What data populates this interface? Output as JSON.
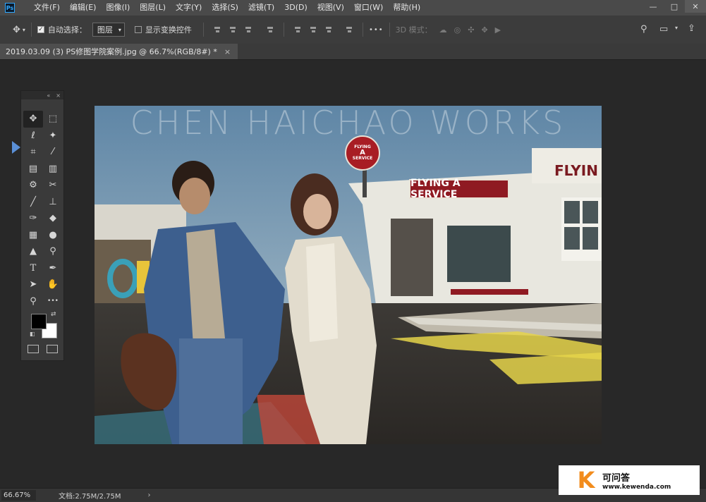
{
  "menubar": {
    "logo": "Ps",
    "items": [
      "文件(F)",
      "编辑(E)",
      "图像(I)",
      "图层(L)",
      "文字(Y)",
      "选择(S)",
      "滤镜(T)",
      "3D(D)",
      "视图(V)",
      "窗口(W)",
      "帮助(H)"
    ],
    "window_buttons": [
      "—",
      "□",
      "✕"
    ]
  },
  "optionsbar": {
    "auto_select_label": "自动选择：",
    "auto_select_checked": true,
    "layer_dropdown": "图层",
    "show_transform_label": "显示变换控件",
    "show_transform_checked": false,
    "more": "•••",
    "mode_3d_label": "3D 模式："
  },
  "document_tab": {
    "title": "2019.03.09  (3)  PS修图学院案例.jpg @ 66.7%(RGB/8#) *",
    "close": "×"
  },
  "toolbar": {
    "header_icons": [
      "«",
      "×"
    ],
    "tools": [
      {
        "name": "move-tool",
        "glyph": "✥"
      },
      {
        "name": "marquee-tool",
        "glyph": "⬚"
      },
      {
        "name": "lasso-tool",
        "glyph": "ℓ"
      },
      {
        "name": "magic-wand-tool",
        "glyph": "✦"
      },
      {
        "name": "crop-tool",
        "glyph": "⌗"
      },
      {
        "name": "eyedropper-tool",
        "glyph": "⁄"
      },
      {
        "name": "spot-healing-tool",
        "glyph": "▤"
      },
      {
        "name": "patch-tool",
        "glyph": "▥"
      },
      {
        "name": "content-aware-tool",
        "glyph": "⚙"
      },
      {
        "name": "red-eye-tool",
        "glyph": "✂"
      },
      {
        "name": "brush-tool",
        "glyph": "╱"
      },
      {
        "name": "stamp-tool",
        "glyph": "⊥"
      },
      {
        "name": "history-brush-tool",
        "glyph": "✑"
      },
      {
        "name": "eraser-tool",
        "glyph": "◆"
      },
      {
        "name": "gradient-tool",
        "glyph": "▦"
      },
      {
        "name": "blur-tool",
        "glyph": "●"
      },
      {
        "name": "sharpen-tool",
        "glyph": "▲"
      },
      {
        "name": "dodge-tool",
        "glyph": "⚲"
      },
      {
        "name": "type-tool",
        "glyph": "T"
      },
      {
        "name": "pen-tool",
        "glyph": "✒"
      },
      {
        "name": "path-selection-tool",
        "glyph": "➤"
      },
      {
        "name": "hand-tool",
        "glyph": "✋"
      },
      {
        "name": "zoom-tool",
        "glyph": "⚲"
      },
      {
        "name": "more-tools",
        "glyph": "•••"
      }
    ],
    "foreground_color": "#000000",
    "background_color": "#ffffff"
  },
  "canvas": {
    "watermark": "CHEN HAICHAO WORKS",
    "sign_main": "FLYING A SERVICE",
    "sign_roof": "FLYIN",
    "round_sign": [
      "FLYING",
      "A",
      "SERVICE"
    ]
  },
  "statusbar": {
    "zoom": "66.67%",
    "doc_info": "文档:2.75M/2.75M",
    "arrow": "›"
  },
  "site_logo": {
    "letter": "K",
    "name": "可问答",
    "url": "www.kewenda.com"
  }
}
